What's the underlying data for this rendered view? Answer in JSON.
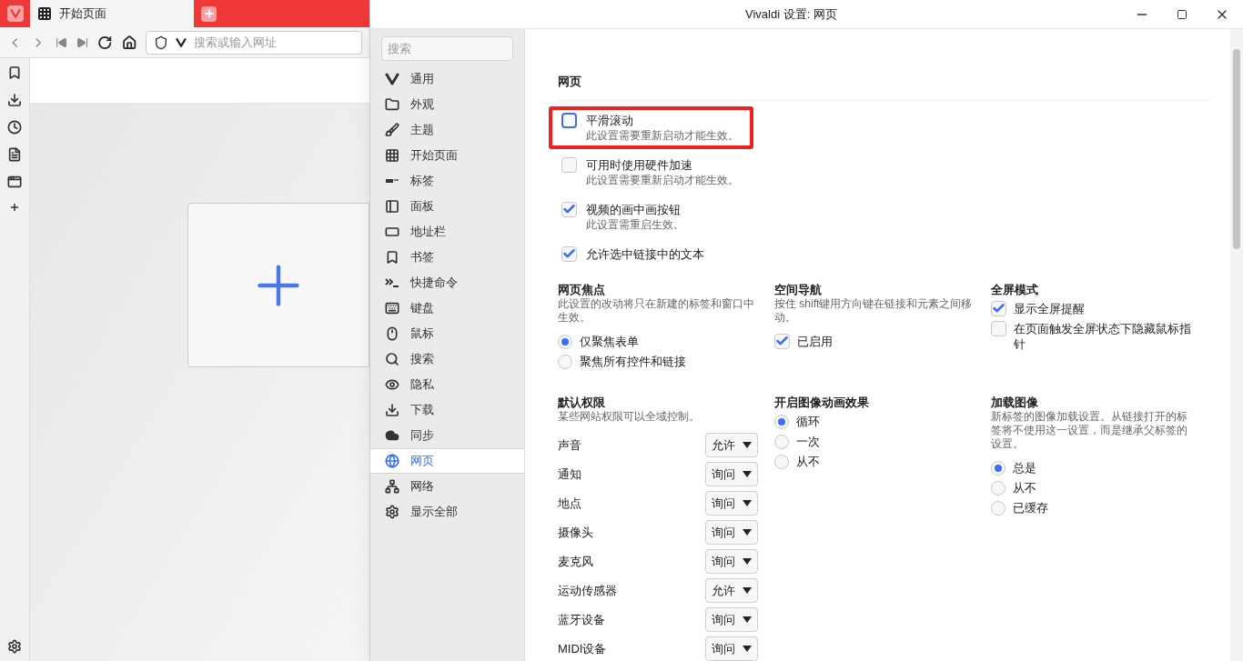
{
  "browser": {
    "tabs": [
      {
        "label": "开始页面",
        "selected": true
      }
    ],
    "address_bar": {
      "placeholder": "搜索或输入网址"
    }
  },
  "settings_window": {
    "title": "Vivaldi 设置: 网页",
    "sidebar": {
      "search_placeholder": "搜索",
      "items": [
        {
          "label": "通用",
          "selected": false
        },
        {
          "label": "外观",
          "selected": false
        },
        {
          "label": "主题",
          "selected": false
        },
        {
          "label": "开始页面",
          "selected": false
        },
        {
          "label": "标签",
          "selected": false
        },
        {
          "label": "面板",
          "selected": false
        },
        {
          "label": "地址栏",
          "selected": false
        },
        {
          "label": "书签",
          "selected": false
        },
        {
          "label": "快捷命令",
          "selected": false
        },
        {
          "label": "键盘",
          "selected": false
        },
        {
          "label": "鼠标",
          "selected": false
        },
        {
          "label": "搜索",
          "selected": false
        },
        {
          "label": "隐私",
          "selected": false
        },
        {
          "label": "下载",
          "selected": false
        },
        {
          "label": "同步",
          "selected": false
        },
        {
          "label": "网页",
          "selected": true
        },
        {
          "label": "网络",
          "selected": false
        },
        {
          "label": "显示全部",
          "selected": false
        }
      ]
    },
    "section_title": "网页",
    "checkboxes": [
      {
        "label": "平滑滚动",
        "hint": "此设置需要重新启动才能生效。",
        "checked": false,
        "highlighted": true
      },
      {
        "label": "可用时使用硬件加速",
        "hint": "此设置需要重新启动才能生效。",
        "checked": false,
        "highlighted": false
      },
      {
        "label": "视频的画中画按钮",
        "hint": "此设置需重启生效。",
        "checked": true,
        "highlighted": false
      },
      {
        "label": "允许选中链接中的文本",
        "checked": true,
        "highlighted": false
      }
    ],
    "rows": [
      [
        {
          "title": "网页焦点",
          "description": "此设置的改动将只在新建的标签和窗口中生效。",
          "options": [
            {
              "kind": "radio",
              "label": "仅聚焦表单",
              "selected": true
            },
            {
              "kind": "radio",
              "label": "聚焦所有控件和链接",
              "selected": false
            }
          ]
        },
        {
          "title": "空间导航",
          "description": "按住 shift键用方向键在链接和元素之间移动。",
          "options": [
            {
              "kind": "checkbox",
              "label": "已启用",
              "checked": true
            }
          ]
        },
        {
          "title": "全屏模式",
          "options": [
            {
              "kind": "checkbox",
              "label": "显示全屏提醒",
              "checked": true
            },
            {
              "kind": "checkbox",
              "label": "在页面触发全屏状态下隐藏鼠标指针",
              "checked": false
            }
          ]
        }
      ],
      [
        {
          "title": "默认权限",
          "description": "某些网站权限可以全域控制。",
          "options": [
            {
              "kind": "select",
              "label": "声音",
              "value": "允许"
            },
            {
              "kind": "select",
              "label": "通知",
              "value": "询问"
            },
            {
              "kind": "select",
              "label": "地点",
              "value": "询问"
            },
            {
              "kind": "select",
              "label": "摄像头",
              "value": "询问"
            },
            {
              "kind": "select",
              "label": "麦克风",
              "value": "询问"
            },
            {
              "kind": "select",
              "label": "运动传感器",
              "value": "允许"
            },
            {
              "kind": "select",
              "label": "蓝牙设备",
              "value": "询问"
            },
            {
              "kind": "select",
              "label": "MIDI设备",
              "value": "询问"
            }
          ]
        },
        {
          "title": "开启图像动画效果",
          "options": [
            {
              "kind": "radio",
              "label": "循环",
              "selected": true
            },
            {
              "kind": "radio",
              "label": "一次",
              "selected": false
            },
            {
              "kind": "radio",
              "label": "从不",
              "selected": false
            }
          ]
        },
        {
          "title": "加载图像",
          "description": "新标签的图像加载设置。从链接打开的标签将不使用这一设置，而是继承父标签的设置。",
          "options": [
            {
              "kind": "radio",
              "label": "总是",
              "selected": true
            },
            {
              "kind": "radio",
              "label": "从不",
              "selected": false
            },
            {
              "kind": "radio",
              "label": "已缓存",
              "selected": false
            }
          ]
        }
      ]
    ]
  }
}
